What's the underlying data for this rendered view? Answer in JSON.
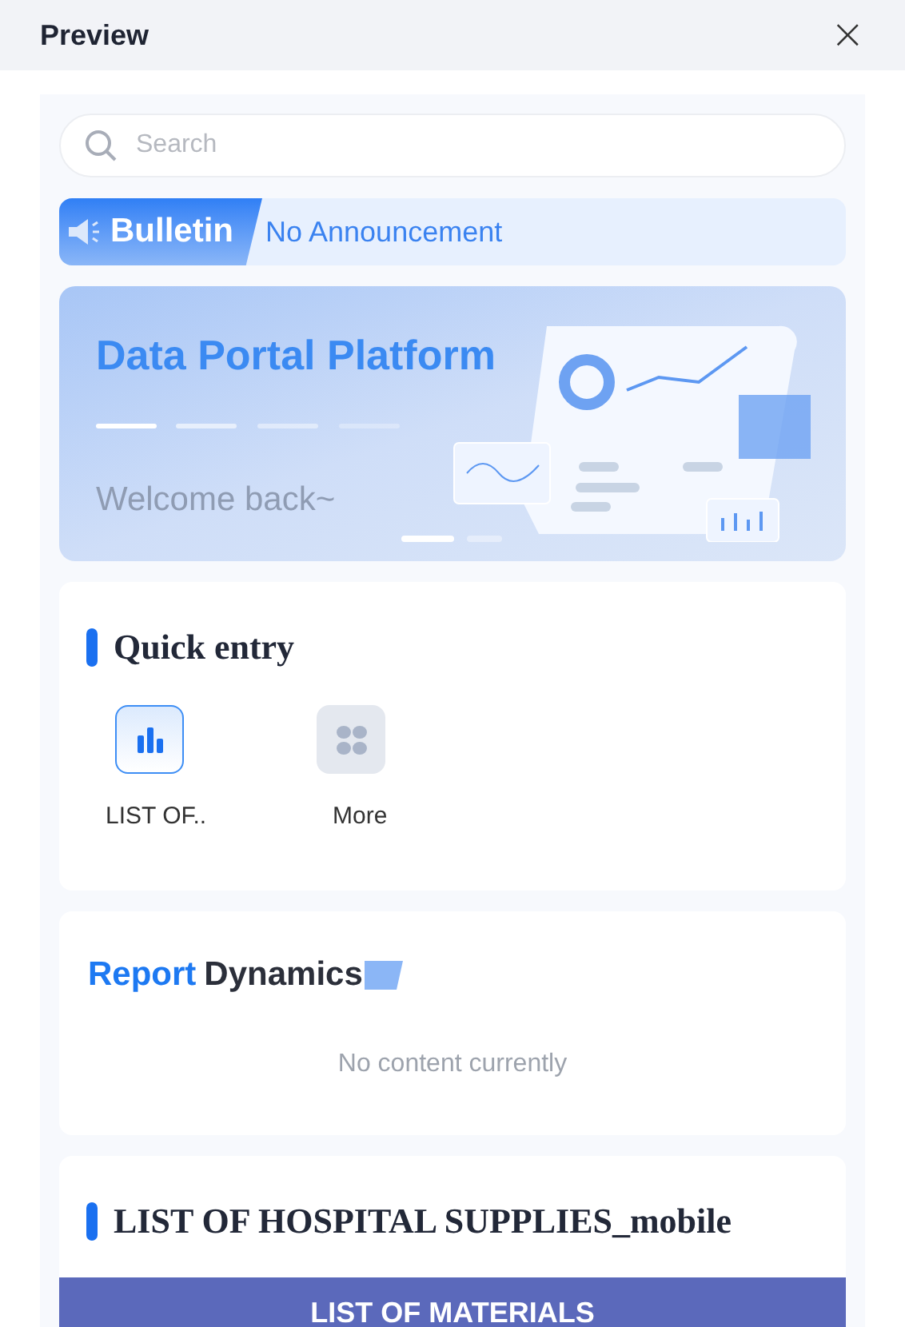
{
  "window": {
    "title": "Preview",
    "close": "×"
  },
  "search": {
    "placeholder": "Search"
  },
  "bulletin": {
    "label": "Bulletin",
    "text": "No Announcement"
  },
  "banner": {
    "title": "Data Portal Platform",
    "subtitle": "Welcome back~",
    "slides": [
      {
        "selected": true
      },
      {
        "selected": false
      }
    ]
  },
  "quick_entry": {
    "title": "Quick entry",
    "items": [
      {
        "kind": "report",
        "label": "LIST OF.."
      },
      {
        "kind": "more",
        "label": "More"
      }
    ]
  },
  "report_dynamics": {
    "title_accent": "Report",
    "title_rest": "Dynamics",
    "empty": "No content currently"
  },
  "report": {
    "title": "LIST OF HOSPITAL SUPPLIES_mobile",
    "banner": "LIST OF MATERIALS"
  }
}
